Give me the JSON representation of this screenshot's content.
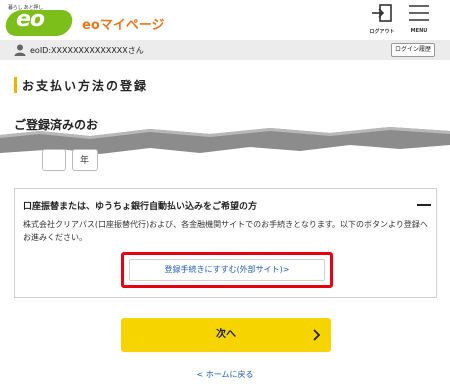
{
  "header": {
    "logo_tagline": "暮らし あと押し",
    "logo_text": "eo",
    "brand_title": "eoマイページ",
    "logout_label": "ログアウト",
    "menu_label": "MENU"
  },
  "userbar": {
    "user_id": "eoID:XXXXXXXXXXXXXXさん",
    "login_history_label": "ログイン履歴"
  },
  "page": {
    "title": "お支払い方法の登録",
    "registered_heading": "ご登録済みのお",
    "year_label": "年"
  },
  "card": {
    "title": "口座振替または、ゆうちょ銀行自動払い込みをご希望の方",
    "description": "株式会社クリアパス(口座振替代行)および、各金融機関サイトでのお手続きとなります。以下のボタンより登録へお進みください。",
    "register_button": "登録手続きにすすむ(外部サイト)>"
  },
  "actions": {
    "next_label": "次へ",
    "home_link": "< ホームに戻る"
  },
  "colors": {
    "brand_green": "#7cbf1a",
    "brand_orange": "#e8771e",
    "accent_yellow": "#f5d400",
    "highlight_red": "#e60012",
    "link_blue": "#1e5bbd"
  }
}
